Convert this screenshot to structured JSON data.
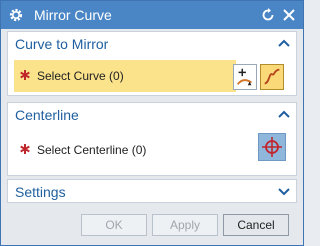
{
  "window": {
    "title": "Mirror Curve",
    "icons": [
      "gear-icon",
      "reset-icon",
      "close-icon"
    ]
  },
  "sections": {
    "curve_to_mirror": {
      "title": "Curve to Mirror",
      "select_label": "Select Curve (0)",
      "icons": [
        "curve-rule-icon",
        "spline-icon"
      ]
    },
    "centerline": {
      "title": "Centerline",
      "select_label": "Select Centerline (0)",
      "icons": [
        "crosshair-icon"
      ]
    },
    "settings": {
      "title": "Settings"
    }
  },
  "footer": {
    "ok_label": "OK",
    "apply_label": "Apply",
    "cancel_label": "Cancel"
  },
  "colors": {
    "titlebar": "#4a86c6",
    "section_title": "#1f5f9f",
    "highlight": "#fbe38c",
    "required": "#c0272d"
  }
}
